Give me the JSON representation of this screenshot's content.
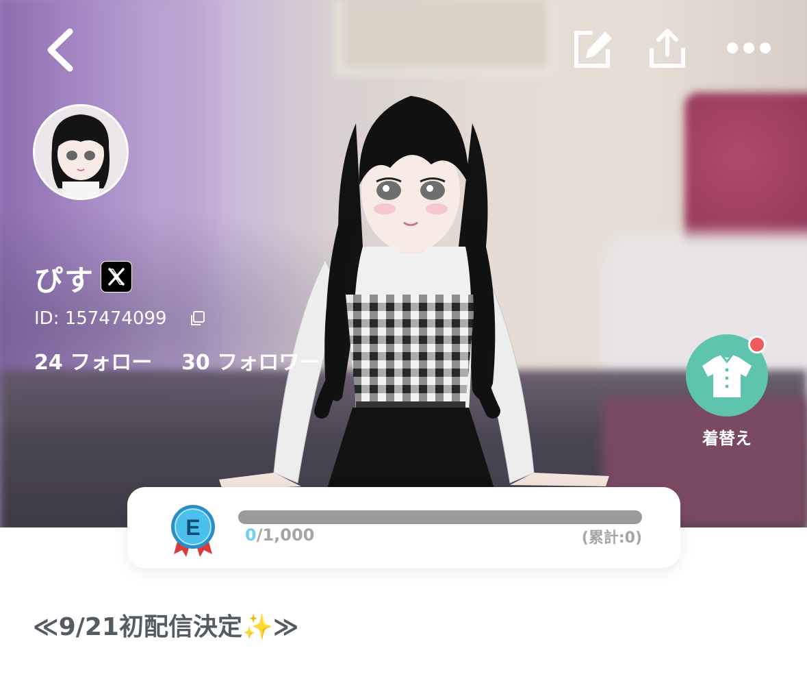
{
  "header": {
    "back_icon": "chevron-left-icon",
    "edit_icon": "edit-icon",
    "share_icon": "share-icon",
    "more_icon": "more-horizontal-icon"
  },
  "profile": {
    "name": "ぴす",
    "x_badge": "𝕏",
    "id_text": "ID: 157474099",
    "following": "24 フォロー",
    "followers": "30 フォロワー"
  },
  "dress_up": {
    "label": "着替え",
    "icon": "shirt-icon",
    "notification": true
  },
  "level": {
    "rank": "E",
    "current": "0",
    "target": "/1,000",
    "total": "(累計:0)",
    "progress": 0
  },
  "bio": "≪9/21初配信決定✨≫",
  "colors": {
    "accent_teal": "#5ec4ad",
    "notification_red": "#ef5a5a",
    "progress_blue": "#5bc7e8",
    "bar_gray": "#9b9b9b",
    "bio_text": "#555b63"
  }
}
